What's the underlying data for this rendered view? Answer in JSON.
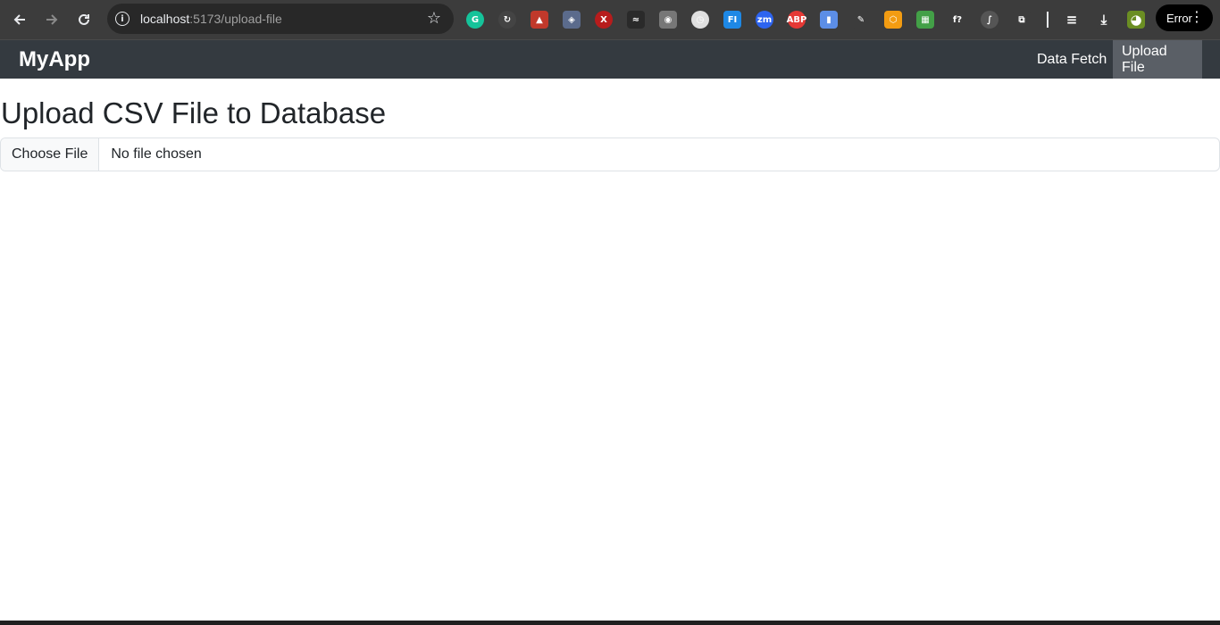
{
  "browser": {
    "url_host": "localhost",
    "url_path": ":5173/upload-file",
    "profile_button_label": "Error",
    "extensions": [
      {
        "name": "grammarly-icon",
        "glyph": "G",
        "color": "#15c39a",
        "round": true
      },
      {
        "name": "sync-icon",
        "glyph": "↻",
        "color": "#444444",
        "round": true
      },
      {
        "name": "shield-red-icon",
        "glyph": "▲",
        "color": "#c0392b",
        "round": false
      },
      {
        "name": "shield-blue-icon",
        "glyph": "◈",
        "color": "#5b6b8c",
        "round": false
      },
      {
        "name": "x-circle-icon",
        "glyph": "X",
        "color": "#b71c1c",
        "round": true
      },
      {
        "name": "wave-icon",
        "glyph": "≈",
        "color": "#2a2a2a",
        "round": false
      },
      {
        "name": "camera-icon",
        "glyph": "◉",
        "color": "#777777",
        "round": false
      },
      {
        "name": "clock-icon",
        "glyph": "◷",
        "color": "#e0e0e0",
        "round": true
      },
      {
        "name": "fi-icon",
        "glyph": "FI",
        "color": "#1e88e5",
        "round": false
      },
      {
        "name": "zm-icon",
        "glyph": "zm",
        "color": "#2d64f0",
        "round": true
      },
      {
        "name": "adblock-icon",
        "glyph": "ABP",
        "color": "#e53935",
        "round": true
      },
      {
        "name": "document-icon",
        "glyph": "▮",
        "color": "#5c8ee6",
        "round": false
      },
      {
        "name": "eyedropper-icon",
        "glyph": "✎",
        "color": "#3c3c3c",
        "round": false
      },
      {
        "name": "hex-icon",
        "glyph": "⬡",
        "color": "#f39c12",
        "round": false
      },
      {
        "name": "qr-icon",
        "glyph": "▦",
        "color": "#43a047",
        "round": false
      },
      {
        "name": "function-icon",
        "glyph": "f?",
        "color": "#3c3c3c",
        "round": false
      },
      {
        "name": "script-icon",
        "glyph": "∫",
        "color": "#555555",
        "round": true
      },
      {
        "name": "puzzle-icon",
        "glyph": "⧉",
        "color": "#3c3c3c",
        "round": false
      }
    ]
  },
  "navbar": {
    "brand": "MyApp",
    "links": [
      "Data Fetch",
      "Upload File"
    ]
  },
  "main": {
    "title": "Upload CSV File to Database",
    "file_button_label": "Choose File",
    "file_status": "No file chosen"
  }
}
